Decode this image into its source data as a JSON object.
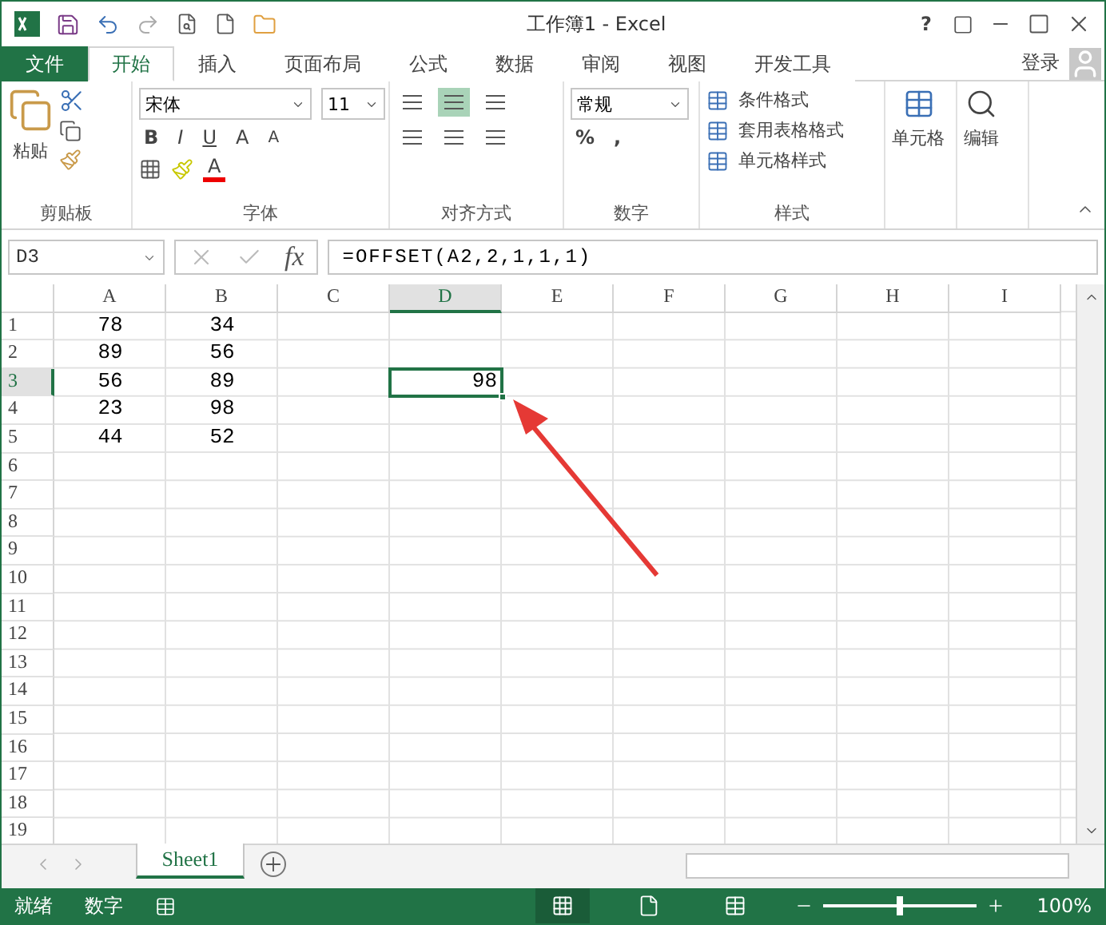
{
  "title_bar": {
    "title": "工作簿1 - Excel",
    "help": "?"
  },
  "tabs": [
    {
      "label": "文件",
      "kind": "file",
      "selected": false
    },
    {
      "label": "开始",
      "kind": "tab",
      "selected": true
    },
    {
      "label": "插入",
      "kind": "tab",
      "selected": false
    },
    {
      "label": "页面布局",
      "kind": "tab",
      "selected": false
    },
    {
      "label": "公式",
      "kind": "tab",
      "selected": false
    },
    {
      "label": "数据",
      "kind": "tab",
      "selected": false
    },
    {
      "label": "审阅",
      "kind": "tab",
      "selected": false
    },
    {
      "label": "视图",
      "kind": "tab",
      "selected": false
    },
    {
      "label": "开发工具",
      "kind": "tab",
      "selected": false
    }
  ],
  "login": "登录",
  "ribbon": {
    "clipboard": {
      "paste": "粘贴",
      "label": "剪贴板"
    },
    "font": {
      "name": "宋体",
      "size": "11",
      "bold": "B",
      "italic": "I",
      "underline": "U",
      "grow": "A",
      "shrink": "A",
      "font_color_button": "A",
      "label": "字体"
    },
    "alignment": {
      "label": "对齐方式",
      "middle_selected": true
    },
    "number": {
      "format": "常规",
      "percent": "%",
      "comma": ",",
      "label": "数字"
    },
    "styles": {
      "items": [
        "条件格式",
        "套用表格格式",
        "单元格样式"
      ],
      "label": "样式"
    },
    "cells": {
      "label": "单元格"
    },
    "editing": {
      "label": "编辑"
    }
  },
  "formula_bar": {
    "name_box": "D3",
    "fx": "fx",
    "formula": "=OFFSET(A2,2,1,1,1)"
  },
  "grid": {
    "columns": [
      {
        "label": "A",
        "selected": false
      },
      {
        "label": "B",
        "selected": false
      },
      {
        "label": "C",
        "selected": false
      },
      {
        "label": "D",
        "selected": true
      },
      {
        "label": "E",
        "selected": false
      },
      {
        "label": "F",
        "selected": false
      },
      {
        "label": "G",
        "selected": false
      },
      {
        "label": "H",
        "selected": false
      },
      {
        "label": "I",
        "selected": false
      }
    ],
    "rows": [
      {
        "number": "1",
        "selected": false,
        "cells": [
          {
            "text": "78",
            "selected": false
          },
          {
            "text": "34",
            "selected": false
          }
        ]
      },
      {
        "number": "2",
        "selected": false,
        "cells": [
          {
            "text": "89",
            "selected": false
          },
          {
            "text": "56",
            "selected": false
          }
        ]
      },
      {
        "number": "3",
        "selected": true,
        "cells": [
          {
            "text": "56",
            "selected": false
          },
          {
            "text": "89",
            "selected": false
          },
          {
            "text": ""
          },
          {
            "text": "98",
            "selected": true
          }
        ]
      },
      {
        "number": "4",
        "selected": false,
        "cells": [
          {
            "text": "23",
            "selected": false
          },
          {
            "text": "98",
            "selected": false
          }
        ]
      },
      {
        "number": "5",
        "selected": false,
        "cells": [
          {
            "text": "44",
            "selected": false
          },
          {
            "text": "52",
            "selected": false
          }
        ]
      },
      {
        "number": "6",
        "selected": false
      },
      {
        "number": "7",
        "selected": false
      },
      {
        "number": "8",
        "selected": false
      },
      {
        "number": "9",
        "selected": false
      },
      {
        "number": "10",
        "selected": false
      },
      {
        "number": "11",
        "selected": false
      },
      {
        "number": "12",
        "selected": false
      },
      {
        "number": "13",
        "selected": false
      },
      {
        "number": "14",
        "selected": false
      },
      {
        "number": "15",
        "selected": false
      },
      {
        "number": "16",
        "selected": false
      },
      {
        "number": "17",
        "selected": false
      },
      {
        "number": "18",
        "selected": false
      },
      {
        "number": "19",
        "selected": false
      }
    ]
  },
  "sheets": [
    {
      "label": "Sheet1",
      "selected": true
    }
  ],
  "status_bar": {
    "ready": "就绪",
    "mode": "数字",
    "views": [
      {
        "kind": "normal",
        "selected": true
      },
      {
        "kind": "page",
        "selected": false
      },
      {
        "kind": "break",
        "selected": false
      }
    ],
    "zoom": {
      "level": 0.5,
      "reading": "100%"
    }
  }
}
